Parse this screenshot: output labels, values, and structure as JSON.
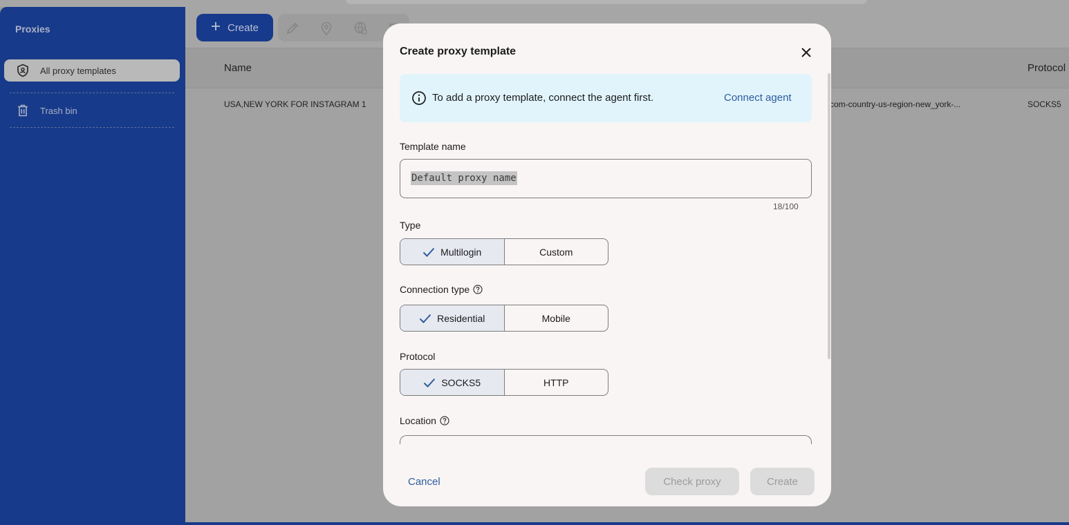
{
  "sidebar": {
    "title": "Proxies",
    "items": [
      {
        "label": "All proxy templates",
        "icon": "shield-icon"
      },
      {
        "label": "Trash bin",
        "icon": "trash-icon"
      }
    ]
  },
  "toolbar": {
    "create_label": "Create",
    "icons": [
      "edit-icon",
      "location-icon",
      "globe-settings-icon",
      "more-icon"
    ]
  },
  "table": {
    "columns": [
      "Name",
      "Protocol"
    ],
    "rows": [
      {
        "name": "USA,NEW YORK FOR INSTAGRAM 1",
        "host": "com-country-us-region-new_york-...",
        "protocol": "SOCKS5"
      }
    ]
  },
  "modal": {
    "title": "Create proxy template",
    "info": {
      "text": "To add a proxy template, connect the agent first.",
      "link": "Connect agent"
    },
    "template_name": {
      "label": "Template name",
      "value": "Default proxy name",
      "counter": "18/100"
    },
    "type": {
      "label": "Type",
      "options": [
        "Multilogin",
        "Custom"
      ],
      "selected": "Multilogin"
    },
    "connection_type": {
      "label": "Connection type",
      "options": [
        "Residential",
        "Mobile"
      ],
      "selected": "Residential"
    },
    "protocol": {
      "label": "Protocol",
      "options": [
        "SOCKS5",
        "HTTP"
      ],
      "selected": "SOCKS5"
    },
    "location": {
      "label": "Location"
    },
    "footer": {
      "cancel": "Cancel",
      "check_proxy": "Check proxy",
      "create": "Create"
    }
  },
  "colors": {
    "sidebar_bg": "#183a8a",
    "accent_link": "#2d5c9d",
    "info_bg": "#e1f4fc",
    "modal_bg": "#f9f5f4",
    "overlay": "#a2a2a2"
  }
}
